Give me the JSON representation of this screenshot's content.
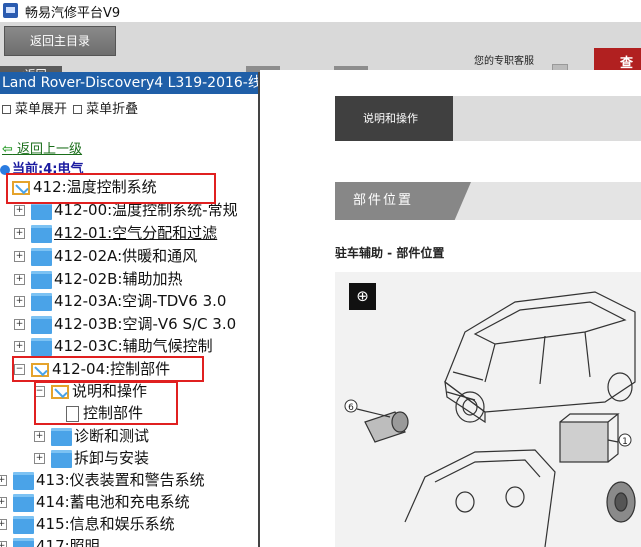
{
  "window": {
    "title": "畅易汽修平台V9"
  },
  "toolbar": {
    "main_menu": "返回主目录",
    "back": "<返回",
    "support": "您的专职客服",
    "red_button": "查看"
  },
  "sidebar": {
    "vehicle": "Land Rover-Discovery4 L319-2016-线",
    "expand_all": "菜单展开",
    "collapse_all": "菜单折叠",
    "back_up": "返回上一级",
    "current": "当前:4:电气",
    "tree": [
      {
        "toggle": "",
        "icon": "envelope",
        "label": "412:温度控制系统"
      },
      {
        "toggle": "+",
        "icon": "folder",
        "label": "412-00:温度控制系统-常规"
      },
      {
        "toggle": "+",
        "icon": "folder",
        "label": "412-01:空气分配和过滤"
      },
      {
        "toggle": "+",
        "icon": "folder",
        "label": "412-02A:供暖和通风"
      },
      {
        "toggle": "+",
        "icon": "folder",
        "label": "412-02B:辅助加热"
      },
      {
        "toggle": "+",
        "icon": "folder",
        "label": "412-03A:空调-TDV6 3.0"
      },
      {
        "toggle": "+",
        "icon": "folder",
        "label": "412-03B:空调-V6 S/C 3.0"
      },
      {
        "toggle": "+",
        "icon": "folder",
        "label": "412-03C:辅助气候控制"
      },
      {
        "toggle": "−",
        "icon": "envelope",
        "label": "412-04:控制部件"
      },
      {
        "toggle": "−",
        "icon": "envelope",
        "label": "说明和操作"
      },
      {
        "toggle": "",
        "icon": "doc",
        "label": "控制部件"
      },
      {
        "toggle": "+",
        "icon": "folder",
        "label": "诊断和测试"
      },
      {
        "toggle": "+",
        "icon": "folder",
        "label": "拆卸与安装"
      },
      {
        "toggle": "+",
        "icon": "folder",
        "label": "413:仪表装置和警告系统"
      },
      {
        "toggle": "+",
        "icon": "folder",
        "label": "414:蓄电池和充电系统"
      },
      {
        "toggle": "+",
        "icon": "folder",
        "label": "415:信息和娱乐系统"
      },
      {
        "toggle": "+",
        "icon": "folder",
        "label": "417:照明"
      }
    ]
  },
  "content": {
    "tab": "说明和操作",
    "section": "部件位置",
    "subtitle": "驻车辅助 - 部件位置",
    "callouts": [
      "6",
      "1"
    ]
  },
  "colors": {
    "highlight_box": "#e02020",
    "vehicle_bar": "#1f5fa8",
    "tab_dark": "#404040",
    "section_grey": "#878787"
  }
}
